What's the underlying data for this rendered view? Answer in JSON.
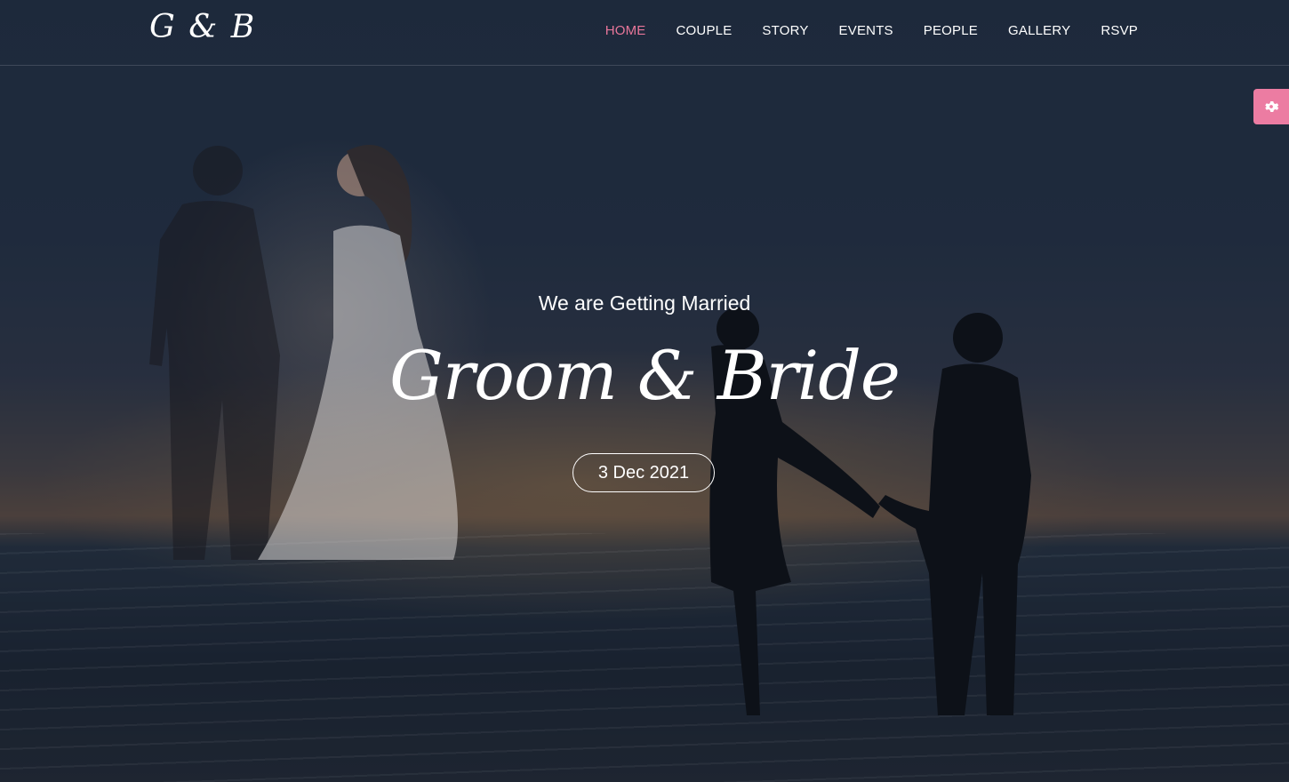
{
  "header": {
    "logo": "G & B",
    "nav": [
      {
        "label": "HOME",
        "active": true
      },
      {
        "label": "COUPLE"
      },
      {
        "label": "STORY"
      },
      {
        "label": "EVENTS"
      },
      {
        "label": "PEOPLE"
      },
      {
        "label": "GALLERY"
      },
      {
        "label": "RSVP"
      }
    ]
  },
  "hero": {
    "tagline": "We are Getting Married",
    "names": "Groom & Bride",
    "date": "3 Dec 2021"
  },
  "widgets": {
    "settings_icon": "gear-icon",
    "settings_color": "#ec7ca2"
  },
  "colors": {
    "accent": "#e8769a"
  }
}
